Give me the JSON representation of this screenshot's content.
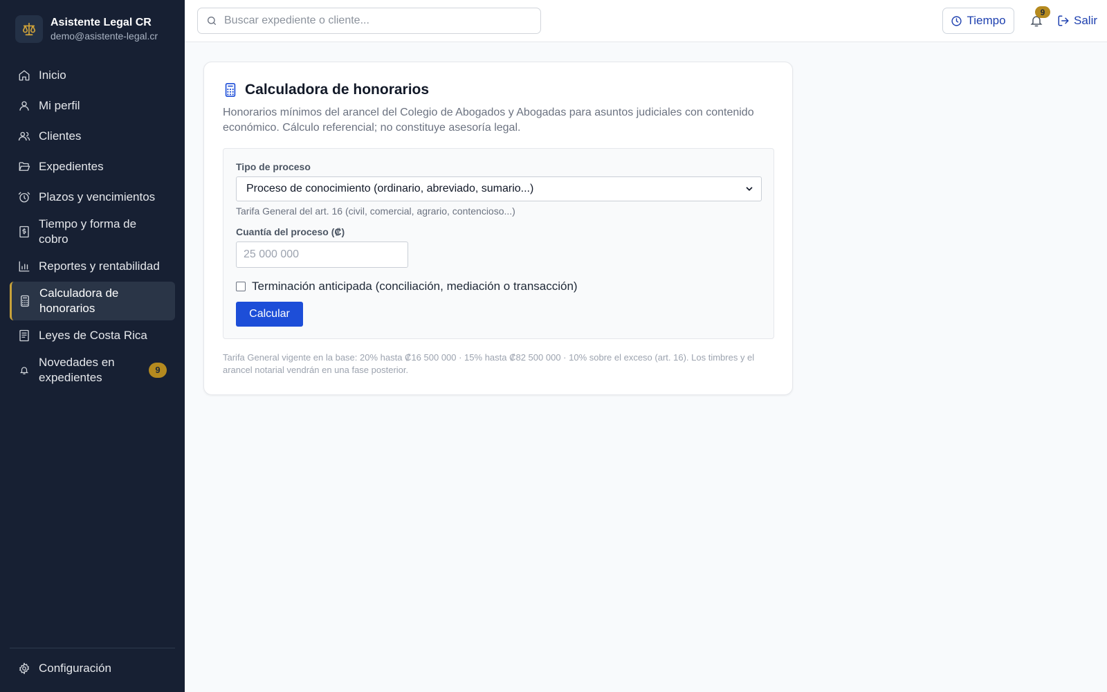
{
  "brand": {
    "title": "Asistente Legal CR",
    "email": "demo@asistente-legal.cr",
    "icon": "scales-icon",
    "accent": "#c8a23a"
  },
  "sidebar": {
    "items": [
      {
        "label": "Inicio",
        "icon": "home-icon"
      },
      {
        "label": "Mi perfil",
        "icon": "user-icon"
      },
      {
        "label": "Clientes",
        "icon": "users-icon"
      },
      {
        "label": "Expedientes",
        "icon": "folder-open-icon"
      },
      {
        "label": "Plazos y vencimientos",
        "icon": "alarm-clock-icon"
      },
      {
        "label": "Tiempo y forma de cobro",
        "icon": "receipt-icon"
      },
      {
        "label": "Reportes y rentabilidad",
        "icon": "bar-chart-icon"
      },
      {
        "label": "Calculadora de honorarios",
        "icon": "calculator-icon",
        "active": true
      },
      {
        "label": "Leyes de Costa Rica",
        "icon": "book-icon"
      },
      {
        "label": "Novedades en expedientes",
        "icon": "bell-icon",
        "badge": "9"
      }
    ],
    "settings_label": "Configuración"
  },
  "topbar": {
    "search_placeholder": "Buscar expediente o cliente...",
    "tiempo_label": "Tiempo",
    "notifications_count": "9",
    "salir_label": "Salir"
  },
  "calculator": {
    "title": "Calculadora de honorarios",
    "description": "Honorarios mínimos del arancel del Colegio de Abogados y Abogadas para asuntos judiciales con contenido económico. Cálculo referencial; no constituye asesoría legal.",
    "process_type_label": "Tipo de proceso",
    "process_type_selected": "Proceso de conocimiento (ordinario, abreviado, sumario...)",
    "process_type_hint": "Tarifa General del art. 16 (civil, comercial, agrario, contencioso...)",
    "amount_label": "Cuantía del proceso (₡)",
    "amount_placeholder": "25 000 000",
    "early_termination_label": "Terminación anticipada (conciliación, mediación o transacción)",
    "calculate_label": "Calcular",
    "footnote": "Tarifa General vigente en la base: 20% hasta ₡16 500 000 · 15% hasta ₡82 500 000 · 10% sobre el exceso (art. 16). Los timbres y el arancel notarial vendrán en una fase posterior."
  },
  "colors": {
    "sidebar_bg": "#172033",
    "primary": "#1d4ed8",
    "badge": "#b58a1f"
  }
}
